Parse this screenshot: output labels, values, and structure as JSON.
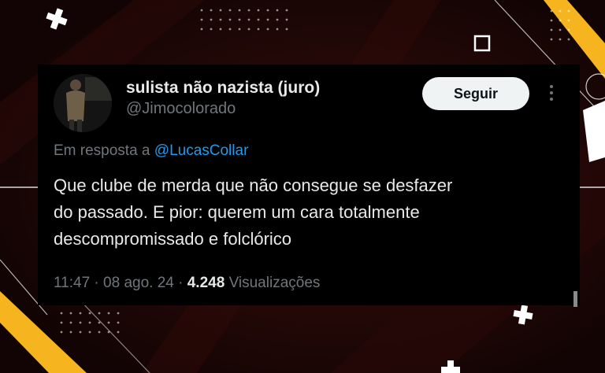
{
  "tweet": {
    "display_name": "sulista não nazista (juro)",
    "handle": "@Jimocolorado",
    "follow_label": "Seguir",
    "reply_prefix": "Em resposta a",
    "reply_mention": "@LucasCollar",
    "text_lines": [
      "Que clube de merda que não consegue se desfazer",
      "do passado. E pior: querem um cara totalmente",
      "descompromissado e folclórico"
    ],
    "time": "11:47",
    "date": "08 ago. 24",
    "separator": "·",
    "views_count": "4.248",
    "views_label": "Visualizações"
  },
  "colors": {
    "background": "#1a0605",
    "card": "#000000",
    "accent_yellow": "#f6b51e",
    "link_blue": "#1d9bf0",
    "text_primary": "#e7e9ea",
    "text_secondary": "#71767b",
    "button_bg": "#eff3f4"
  },
  "icons": [
    "more-vertical-icon",
    "plus-icon",
    "square-outline-icon"
  ]
}
